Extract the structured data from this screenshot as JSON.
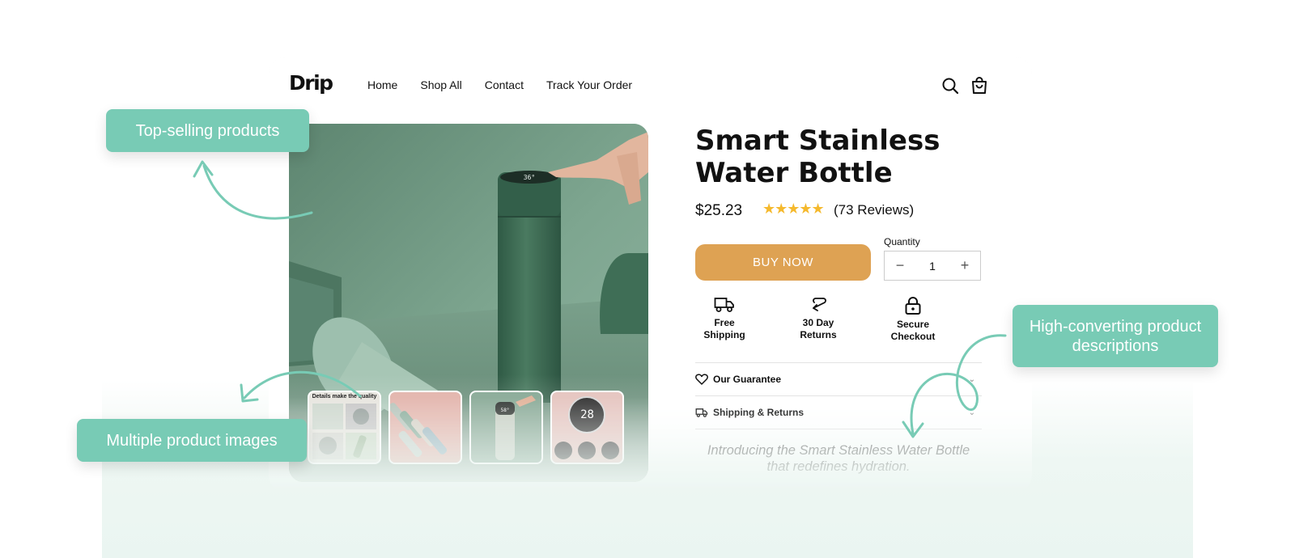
{
  "brand": {
    "logo": "Drip"
  },
  "nav": {
    "items": [
      "Home",
      "Shop All",
      "Contact",
      "Track Your Order"
    ]
  },
  "header_icons": [
    "search-icon",
    "cart-icon"
  ],
  "product": {
    "title": "Smart Stainless Water Bottle",
    "price": "$25.23",
    "rating": 5,
    "stars": "★★★★★",
    "reviews": "(73 Reviews)",
    "buy_label": "BUY NOW",
    "quantity_label": "Quantity",
    "quantity_minus": "−",
    "quantity_plus": "+",
    "quantity": "1",
    "thumbnail_text": "Details make the quality",
    "thumbnail_display": "28"
  },
  "features": [
    {
      "icon": "truck-icon",
      "line1": "Free",
      "line2": "Shipping"
    },
    {
      "icon": "return-arrow-icon",
      "line1": "30 Day",
      "line2": "Returns"
    },
    {
      "icon": "lock-icon",
      "line1": "Secure",
      "line2": "Checkout"
    }
  ],
  "accordion": [
    {
      "icon": "heart-icon",
      "label": "Our Guarantee"
    },
    {
      "icon": "truck-icon",
      "label": "Shipping & Returns"
    }
  ],
  "description": "Introducing the Smart Stainless Water Bottle that redefines hydration.",
  "callouts": {
    "top_selling": "Top-selling products",
    "multiple_images": "Multiple product images",
    "high_converting": "High-converting product descriptions"
  },
  "colors": {
    "accent_button": "#dea253",
    "callout": "#78cbb5",
    "stars": "#f5b92d",
    "product_green": "#6f9580"
  }
}
